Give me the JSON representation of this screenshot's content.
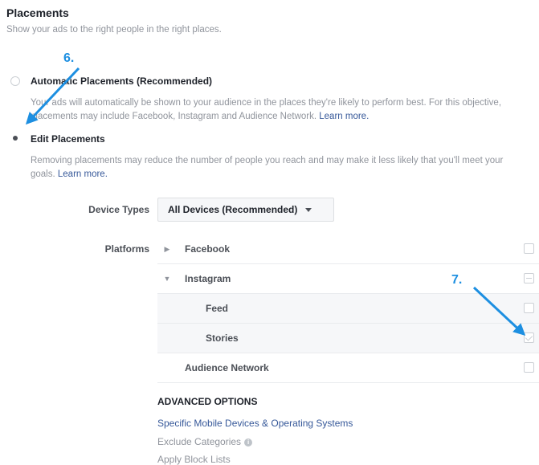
{
  "header": {
    "title": "Placements",
    "subtitle": "Show your ads to the right people in the right places."
  },
  "options": {
    "automatic": {
      "label": "Automatic Placements (Recommended)",
      "description": "Your ads will automatically be shown to your audience in the places they're likely to perform best. For this objective, placements may include Facebook, Instagram and Audience Network.",
      "link": "Learn more.",
      "selected": false
    },
    "edit": {
      "label": "Edit Placements",
      "description": "Removing placements may reduce the number of people you reach and may make it less likely that you'll meet your goals.",
      "link": "Learn more.",
      "selected": true
    }
  },
  "device_types": {
    "label": "Device Types",
    "value": "All Devices (Recommended)"
  },
  "platforms": {
    "label": "Platforms",
    "items": [
      {
        "label": "Facebook",
        "expanded": false,
        "state": "unchecked"
      },
      {
        "label": "Instagram",
        "expanded": true,
        "state": "partial"
      },
      {
        "label": "Feed",
        "state": "unchecked"
      },
      {
        "label": "Stories",
        "state": "checked"
      },
      {
        "label": "Audience Network",
        "state": "unchecked"
      }
    ]
  },
  "advanced": {
    "title": "ADVANCED OPTIONS",
    "link": "Specific Mobile Devices & Operating Systems",
    "exclude": "Exclude Categories",
    "block": "Apply Block Lists"
  },
  "annotations": {
    "step6": "6.",
    "step7": "7."
  },
  "colors": {
    "accent": "#1d8fe1",
    "link": "#365899",
    "muted": "#90949c"
  }
}
